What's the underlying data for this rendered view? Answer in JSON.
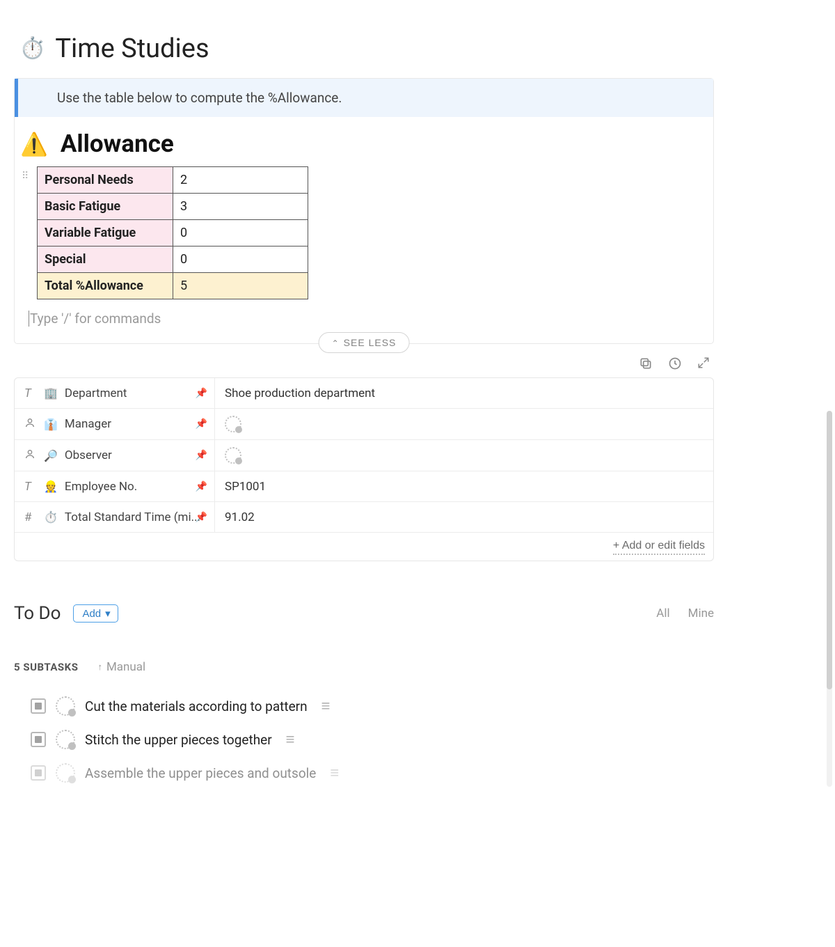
{
  "title": "Time Studies",
  "callout": "Use the table below to compute the %Allowance.",
  "allowance": {
    "heading": "Allowance",
    "rows": [
      {
        "label": "Personal Needs",
        "value": "2"
      },
      {
        "label": "Basic Fatigue",
        "value": "3"
      },
      {
        "label": "Variable Fatigue",
        "value": "0"
      },
      {
        "label": "Special",
        "value": "0"
      }
    ],
    "total_label": "Total %Allowance",
    "total_value": "5"
  },
  "command_placeholder": "Type '/' for commands",
  "see_less": "SEE LESS",
  "properties": [
    {
      "icon_type": "T",
      "emoji": "🏢",
      "label": "Department",
      "value_type": "text",
      "value": "Shoe production department"
    },
    {
      "icon_type": "person",
      "emoji": "👤",
      "label": "Manager",
      "value_type": "person",
      "value": ""
    },
    {
      "icon_type": "person",
      "emoji": "🔎",
      "label": "Observer",
      "value_type": "person",
      "value": ""
    },
    {
      "icon_type": "T",
      "emoji": "👷",
      "label": "Employee No.",
      "value_type": "text",
      "value": "SP1001"
    },
    {
      "icon_type": "#",
      "emoji": "⏱️",
      "label": "Total Standard Time (mi...",
      "value_type": "text",
      "value": "91.02"
    }
  ],
  "add_fields": "+ Add or edit fields",
  "todo": {
    "title": "To Do",
    "add_label": "Add",
    "tabs": {
      "all": "All",
      "mine": "Mine"
    },
    "subtask_count": "5 SUBTASKS",
    "sort_label": "Manual",
    "items": [
      {
        "title": "Cut the materials according to pattern",
        "faded": false
      },
      {
        "title": "Stitch the upper pieces together",
        "faded": false
      },
      {
        "title": "Assemble the upper pieces and outsole",
        "faded": true
      }
    ]
  }
}
